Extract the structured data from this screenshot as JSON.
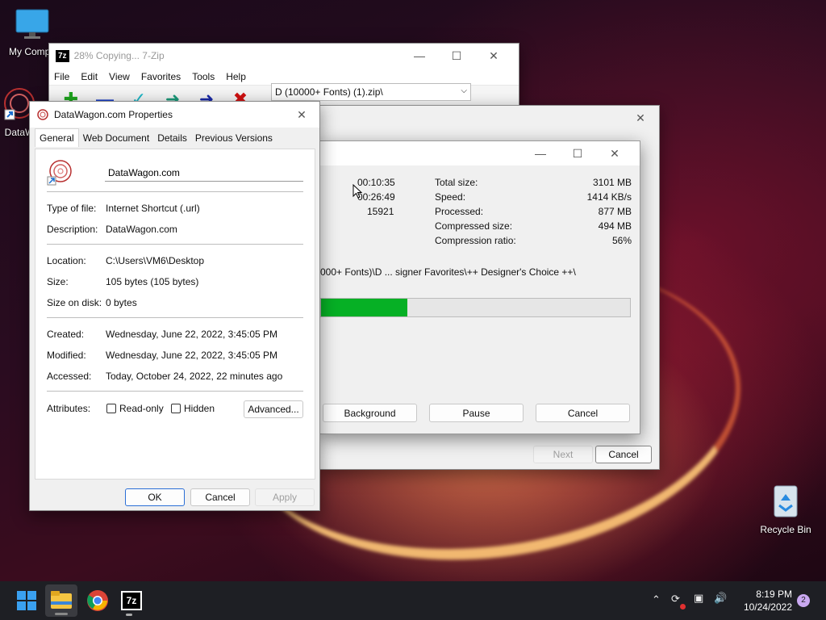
{
  "desktop": {
    "icons": [
      {
        "label": "My Compu"
      },
      {
        "label": "DataW"
      },
      {
        "label": "Recycle Bin"
      }
    ]
  },
  "zip_main": {
    "title": "28% Copying... 7-Zip",
    "menu": [
      "File",
      "Edit",
      "View",
      "Favorites",
      "Tools",
      "Help"
    ],
    "path": "D (10000+ Fonts) (1).zip\\"
  },
  "progress": {
    "elapsed": "00:10:35",
    "remaining": "00:26:49",
    "files": "15921",
    "labels": {
      "total": "Total size:",
      "speed": "Speed:",
      "processed": "Processed:",
      "compressed": "Compressed size:",
      "ratio": "Compression ratio:"
    },
    "values": {
      "total": "3101 MB",
      "speed": "1414 KB/s",
      "processed": "877 MB",
      "compressed": "494 MB",
      "ratio": "56%"
    },
    "current_file": "000+ Fonts)\\D ... signer Favorites\\++ Designer's Choice ++\\",
    "percent": 28,
    "buttons": {
      "background": "Background",
      "pause": "Pause",
      "cancel": "Cancel"
    }
  },
  "wizard": {
    "next": "Next",
    "cancel": "Cancel"
  },
  "props": {
    "title": "DataWagon.com Properties",
    "tabs": [
      "General",
      "Web Document",
      "Details",
      "Previous Versions"
    ],
    "name": "DataWagon.com",
    "rows": {
      "type_k": "Type of file:",
      "type_v": "Internet Shortcut (.url)",
      "desc_k": "Description:",
      "desc_v": "DataWagon.com",
      "loc_k": "Location:",
      "loc_v": "C:\\Users\\VM6\\Desktop",
      "size_k": "Size:",
      "size_v": "105 bytes (105 bytes)",
      "disk_k": "Size on disk:",
      "disk_v": "0 bytes",
      "created_k": "Created:",
      "created_v": "Wednesday, June 22, 2022, 3:45:05 PM",
      "modified_k": "Modified:",
      "modified_v": "Wednesday, June 22, 2022, 3:45:05 PM",
      "accessed_k": "Accessed:",
      "accessed_v": "Today, October 24, 2022, 22 minutes ago",
      "attr_k": "Attributes:"
    },
    "readonly": "Read-only",
    "hidden": "Hidden",
    "advanced": "Advanced...",
    "ok": "OK",
    "cancel": "Cancel",
    "apply": "Apply"
  },
  "taskbar": {
    "time": "8:19 PM",
    "date": "10/24/2022",
    "notifications": "2",
    "zip_label": "7z"
  }
}
